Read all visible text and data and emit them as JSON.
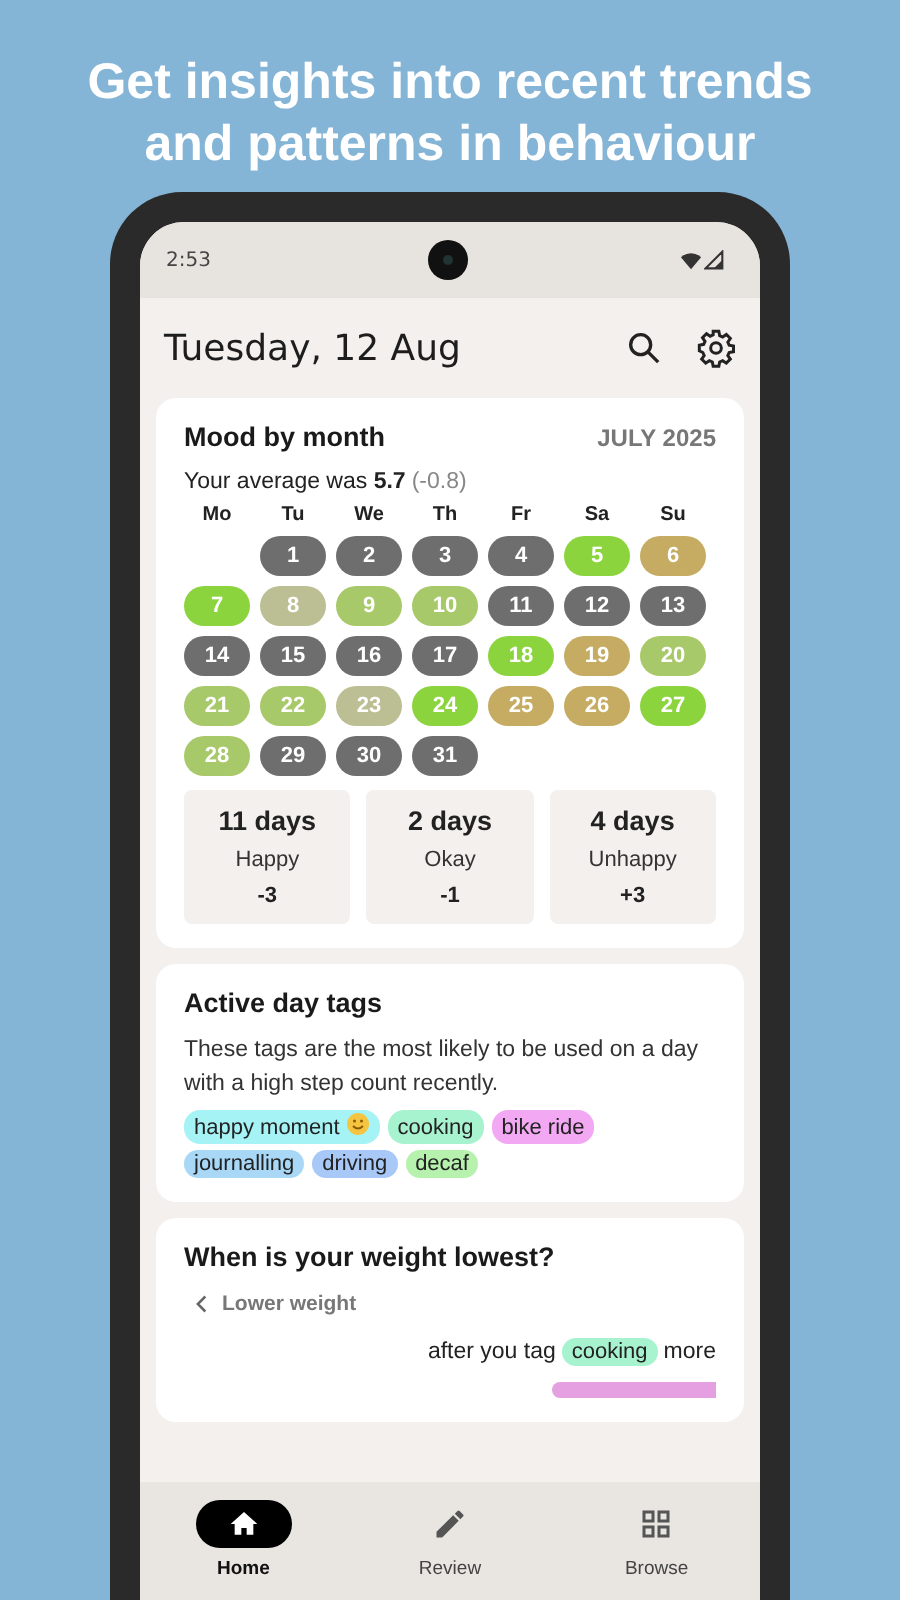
{
  "headline": "Get insights into recent trends and patterns in behaviour",
  "status_bar": {
    "time": "2:53"
  },
  "app_bar": {
    "title": "Tuesday, 12 Aug"
  },
  "mood_card": {
    "title": "Mood by month",
    "month": "JULY 2025",
    "average": "Your average was **5.7**",
    "average_change": "(-0.8)",
    "weekdays": [
      "Mo",
      "Tu",
      "We",
      "Th",
      "Fr",
      "Sa",
      "Su"
    ],
    "weeks": [
      [
        {
          "kind": "blank"
        },
        {
          "kind": "day",
          "label": "1",
          "color": "#6e6e6e"
        },
        {
          "kind": "day",
          "label": "2",
          "color": "#6e6e6e"
        },
        {
          "kind": "day",
          "label": "3",
          "color": "#6e6e6e"
        },
        {
          "kind": "day",
          "label": "4",
          "color": "#6e6e6e"
        },
        {
          "kind": "day",
          "label": "5",
          "color": "#8cd43e"
        },
        {
          "kind": "day",
          "label": "6",
          "color": "#c5ac62"
        }
      ],
      [
        {
          "kind": "day",
          "label": "7",
          "color": "#8cd43e"
        },
        {
          "kind": "day",
          "label": "8",
          "color": "#bcbf93"
        },
        {
          "kind": "day",
          "label": "9",
          "color": "#a8c96a"
        },
        {
          "kind": "day",
          "label": "10",
          "color": "#a8c96a"
        },
        {
          "kind": "day",
          "label": "11",
          "color": "#6e6e6e"
        },
        {
          "kind": "day",
          "label": "12",
          "color": "#6e6e6e"
        },
        {
          "kind": "day",
          "label": "13",
          "color": "#6e6e6e"
        }
      ],
      [
        {
          "kind": "day",
          "label": "14",
          "color": "#6e6e6e"
        },
        {
          "kind": "day",
          "label": "15",
          "color": "#6e6e6e"
        },
        {
          "kind": "day",
          "label": "16",
          "color": "#6e6e6e"
        },
        {
          "kind": "day",
          "label": "17",
          "color": "#6e6e6e"
        },
        {
          "kind": "day",
          "label": "18",
          "color": "#8cd43e"
        },
        {
          "kind": "day",
          "label": "19",
          "color": "#c5ac62"
        },
        {
          "kind": "day",
          "label": "20",
          "color": "#a8c96a"
        }
      ],
      [
        {
          "kind": "day",
          "label": "21",
          "color": "#a8c96a"
        },
        {
          "kind": "day",
          "label": "22",
          "color": "#a8c96a"
        },
        {
          "kind": "day",
          "label": "23",
          "color": "#bcbf93"
        },
        {
          "kind": "day",
          "label": "24",
          "color": "#8cd43e"
        },
        {
          "kind": "day",
          "label": "25",
          "color": "#c5ac62"
        },
        {
          "kind": "day",
          "label": "26",
          "color": "#c5ac62"
        },
        {
          "kind": "day",
          "label": "27",
          "color": "#8cd43e"
        }
      ],
      [
        {
          "kind": "day",
          "label": "28",
          "color": "#a8c96a"
        },
        {
          "kind": "day",
          "label": "29",
          "color": "#6e6e6e"
        },
        {
          "kind": "day",
          "label": "30",
          "color": "#6e6e6e"
        },
        {
          "kind": "day",
          "label": "31",
          "color": "#6e6e6e"
        }
      ]
    ],
    "summary": [
      {
        "count": "11 days",
        "label": "Happy",
        "change": "-3"
      },
      {
        "count": "2 days",
        "label": "Okay",
        "change": "-1"
      },
      {
        "count": "4 days",
        "label": "Unhappy",
        "change": "+3"
      }
    ]
  },
  "tags_card": {
    "title": "Active day tags",
    "description": "These tags are the most likely to be used on a day with a high step count recently.",
    "tags": [
      {
        "kind": "emoji",
        "label": "happy moment",
        "color": "#a6f3f6"
      },
      {
        "kind": "plain",
        "label": "cooking",
        "color": "#a8f3cf"
      },
      {
        "kind": "plain",
        "label": "bike ride",
        "color": "#f2a8f2"
      },
      {
        "kind": "plain",
        "label": "journalling",
        "color": "#a8d8f6"
      },
      {
        "kind": "plain",
        "label": "driving",
        "color": "#a8c8f8"
      },
      {
        "kind": "plain",
        "label": "decaf",
        "color": "#b6f2ae"
      }
    ]
  },
  "weight_card": {
    "title": "When is your weight lowest?",
    "back_link": "Lower weight",
    "prefix": "after you tag",
    "tag": {
      "label": "cooking",
      "color": "#a8f3cf"
    },
    "suffix": "more"
  },
  "nav": [
    {
      "label": "Home",
      "selected": true
    },
    {
      "label": "Review",
      "selected": false
    },
    {
      "label": "Browse",
      "selected": false
    }
  ]
}
